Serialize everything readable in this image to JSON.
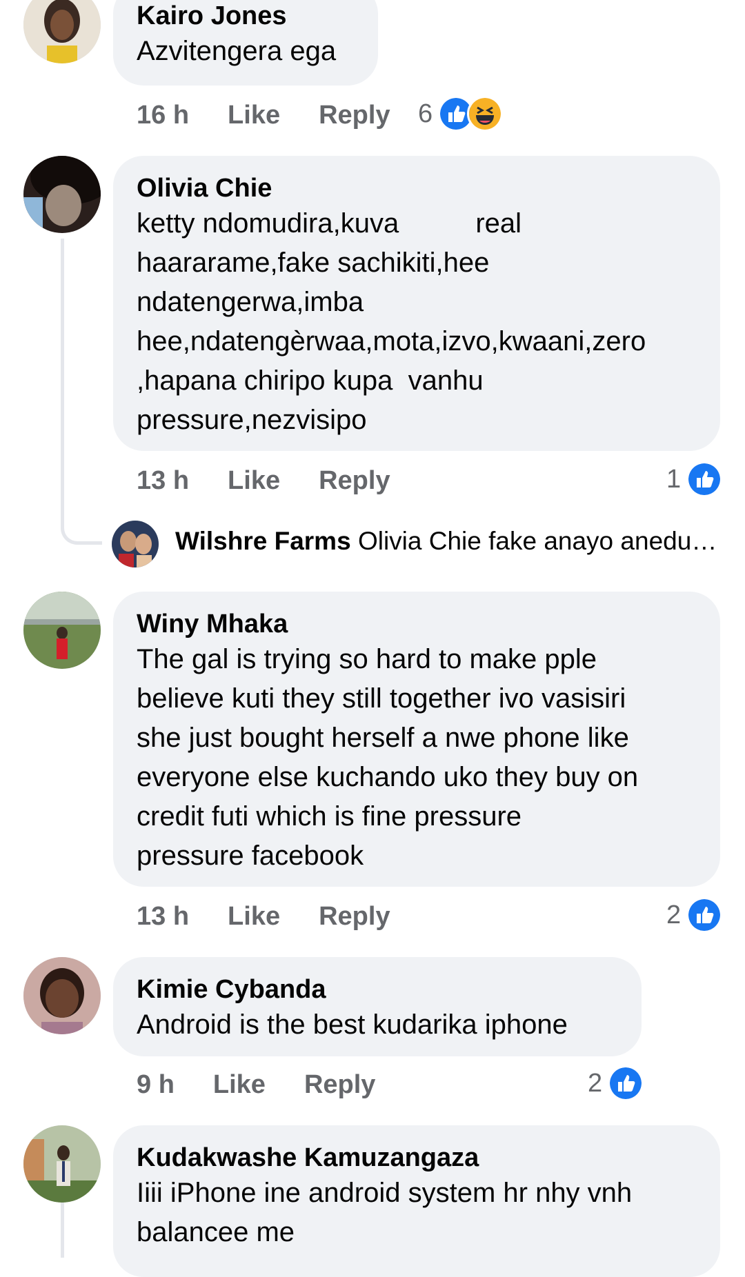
{
  "colors": {
    "like_blue": "#1877f2",
    "haha_yellow": "#f7b125",
    "meta_gray": "#65676b",
    "bubble_bg": "#f0f2f5"
  },
  "comments": [
    {
      "author": "Kairo Jones",
      "text": "Azvitengera ega",
      "time": "16 h",
      "like": "Like",
      "reply": "Reply",
      "reaction_count": "6",
      "reactions": [
        "like-icon",
        "haha-icon"
      ]
    },
    {
      "author": "Olivia Chie",
      "text": "ketty ndomudira,kuva          real\nhaararame,fake sachikiti,hee\nndatengerwa,imba\nhee,ndatengèrwaa,mota,izvo,kwaani,zero\n,hapana chiripo kupa  vanhu\npressure,nezvisipo",
      "time": "13 h",
      "like": "Like",
      "reply": "Reply",
      "reaction_count": "1",
      "reactions": [
        "like-icon"
      ],
      "reply_preview": {
        "author": "Wilshre Farms",
        "text": "Olivia Chie fake anayo anedura..."
      }
    },
    {
      "author": "Winy Mhaka",
      "text": "The gal is trying so hard to make pple\nbelieve kuti they still together ivo vasisiri\nshe just bought herself a nwe phone like\neveryone else kuchando uko they buy on\ncredit futi which is fine pressure\npressure facebook",
      "time": "13 h",
      "like": "Like",
      "reply": "Reply",
      "reaction_count": "2",
      "reactions": [
        "like-icon"
      ]
    },
    {
      "author": "Kimie Cybanda",
      "text": "Android is the best kudarika iphone",
      "time": "9 h",
      "like": "Like",
      "reply": "Reply",
      "reaction_count": "2",
      "reactions": [
        "like-icon"
      ]
    },
    {
      "author": "Kudakwashe Kamuzangaza",
      "text": "Iiii iPhone ine android system hr nhy vnh\nbalancee me"
    }
  ]
}
